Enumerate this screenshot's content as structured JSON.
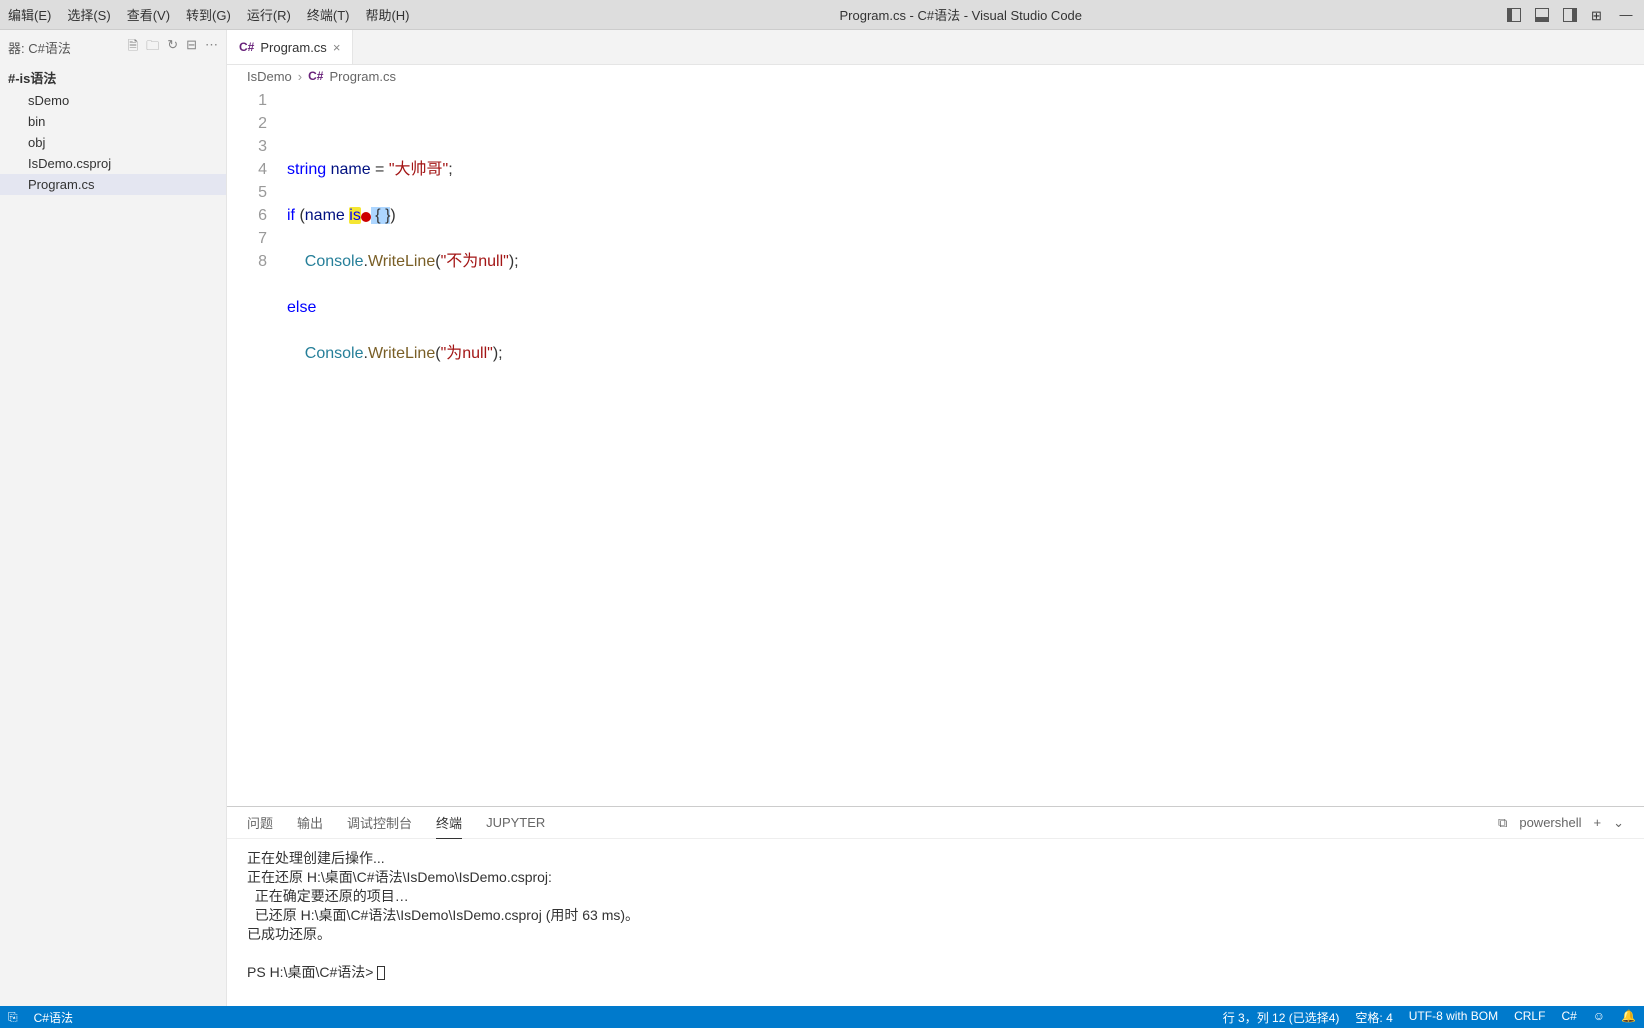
{
  "menu": [
    "编辑(E)",
    "选择(S)",
    "查看(V)",
    "转到(G)",
    "运行(R)",
    "终端(T)",
    "帮助(H)"
  ],
  "window_title": "Program.cs - C#语法 - Visual Studio Code",
  "explorer": {
    "header": "器: C#语法",
    "root": "#-is语法",
    "items": [
      "sDemo",
      "bin",
      "obj",
      "IsDemo.csproj",
      "Program.cs"
    ],
    "active_index": 4
  },
  "tab": {
    "icon": "C#",
    "label": "Program.cs"
  },
  "breadcrumb": {
    "folder": "IsDemo",
    "icon": "C#",
    "file": "Program.cs"
  },
  "code_lines": [
    1,
    2,
    3,
    4,
    5,
    6,
    7,
    8
  ],
  "code": {
    "l2": {
      "type": "string",
      "var": "name",
      "eq": " = ",
      "str": "\"大帅哥\"",
      "semi": ";"
    },
    "l3": {
      "kw_if": "if",
      "open": " (",
      "var": "name",
      "sp": " ",
      "kw_is": "is",
      "sel": " { }",
      "close": ")"
    },
    "l4": {
      "indent": "    ",
      "cls": "Console",
      "dot": ".",
      "fn": "WriteLine",
      "open": "(",
      "str": "\"不为null\"",
      "close": ");"
    },
    "l5": {
      "kw": "else"
    },
    "l6": {
      "indent": "    ",
      "cls": "Console",
      "dot": ".",
      "fn": "WriteLine",
      "open": "(",
      "str": "\"为null\"",
      "close": ");"
    }
  },
  "panel": {
    "tabs": [
      "问题",
      "输出",
      "调试控制台",
      "终端",
      "JUPYTER"
    ],
    "active_tab": 3,
    "shell_label": "powershell",
    "terminal_lines": [
      "正在处理创建后操作...",
      "正在还原 H:\\桌面\\C#语法\\IsDemo\\IsDemo.csproj:",
      "  正在确定要还原的项目…",
      "  已还原 H:\\桌面\\C#语法\\IsDemo\\IsDemo.csproj (用时 63 ms)。",
      "已成功还原。",
      "",
      "PS H:\\桌面\\C#语法> "
    ]
  },
  "statusbar": {
    "branch": "C#语法",
    "position": "行 3，列 12 (已选择4)",
    "spaces": "空格: 4",
    "encoding": "UTF-8 with BOM",
    "eol": "CRLF",
    "lang": "C#"
  }
}
